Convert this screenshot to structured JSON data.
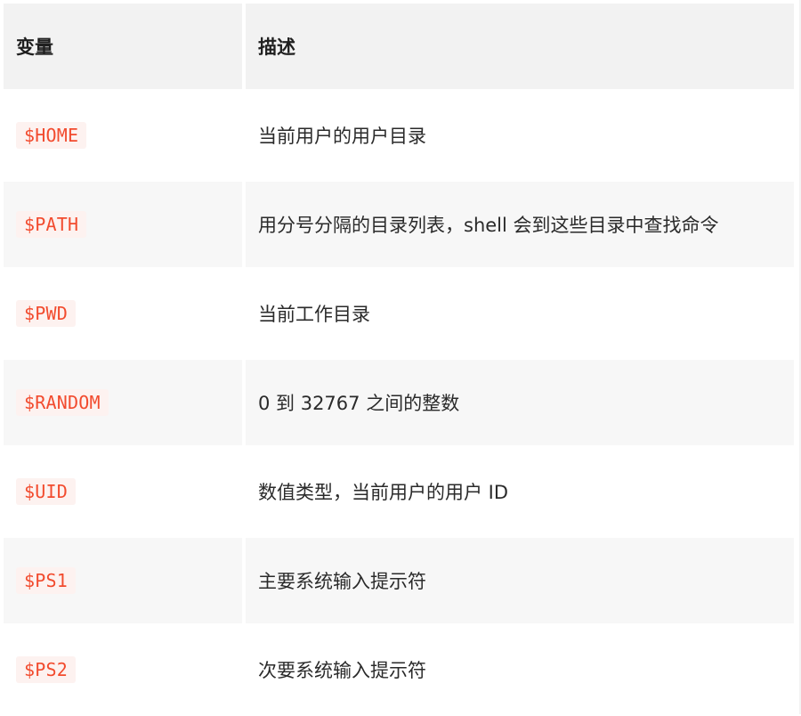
{
  "table": {
    "headers": {
      "variable": "变量",
      "description": "描述"
    },
    "rows": [
      {
        "variable": "$HOME",
        "description": "当前用户的用户目录"
      },
      {
        "variable": "$PATH",
        "description": "用分号分隔的目录列表，shell 会到这些目录中查找命令"
      },
      {
        "variable": "$PWD",
        "description": "当前工作目录"
      },
      {
        "variable": "$RANDOM",
        "description": "0 到 32767 之间的整数"
      },
      {
        "variable": "$UID",
        "description": "数值类型，当前用户的用户 ID"
      },
      {
        "variable": "$PS1",
        "description": "主要系统输入提示符"
      },
      {
        "variable": "$PS2",
        "description": "次要系统输入提示符"
      }
    ]
  },
  "colors": {
    "code_text": "#f24b2e",
    "code_background": "#fdf2f0",
    "header_background": "#f2f2f2",
    "alt_row_background": "#f7f7f7"
  }
}
